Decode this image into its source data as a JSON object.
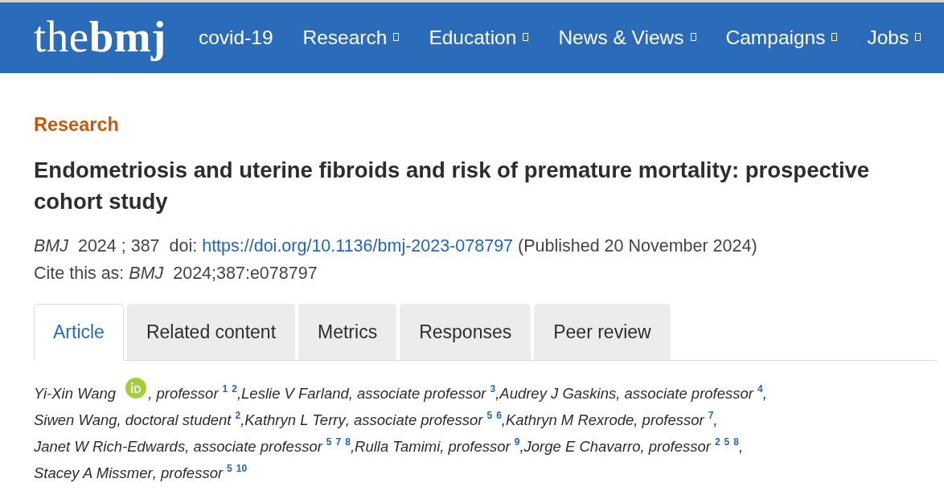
{
  "header": {
    "logo": "the**bmj**",
    "nav": [
      {
        "label": "covid-19",
        "has_dropdown": false
      },
      {
        "label": "Research",
        "has_dropdown": true
      },
      {
        "label": "Education",
        "has_dropdown": true
      },
      {
        "label": "News & Views",
        "has_dropdown": true
      },
      {
        "label": "Campaigns",
        "has_dropdown": true
      },
      {
        "label": "Jobs",
        "has_dropdown": true
      }
    ]
  },
  "article": {
    "section": "Research",
    "title": "Endometriosis and uterine fibroids and risk of premature mortality: prospective cohort study",
    "citation": {
      "text": "*BMJ*  2024 ; 387  doi:",
      "doi_url": "https://doi.org/10.1136/bmj-2023-078797",
      "published": "(Published 20 November 2024)"
    },
    "cite_as": "Cite this as: *BMJ*  2024;387:e078797",
    "tabs": [
      {
        "label": "Article",
        "selected": true
      },
      {
        "label": "Related content",
        "selected": false
      },
      {
        "label": "Metrics",
        "selected": false
      },
      {
        "label": "Responses",
        "selected": false
      },
      {
        "label": "Peer review",
        "selected": false
      }
    ],
    "authors": [
      {
        "name": "Yi-Xin Wang",
        "orcid": true,
        "role": ", professor",
        "affiliations": [
          "1",
          "2"
        ],
        "separator": ","
      },
      {
        "name": "Leslie V Farland",
        "orcid": false,
        "role": ", associate professor",
        "affiliations": [
          "3"
        ],
        "separator": ","
      },
      {
        "name": "Audrey J Gaskins",
        "orcid": false,
        "role": ", associate professor",
        "affiliations": [
          "4"
        ],
        "separator": ","
      },
      {
        "name": "Siwen Wang",
        "orcid": false,
        "role": ", doctoral student",
        "affiliations": [
          "2"
        ],
        "separator": ","
      },
      {
        "name": "Kathryn L Terry",
        "orcid": false,
        "role": ", associate professor",
        "affiliations": [
          "5",
          "6"
        ],
        "separator": ","
      },
      {
        "name": "Kathryn M Rexrode",
        "orcid": false,
        "role": ", professor",
        "affiliations": [
          "7"
        ],
        "separator": ","
      },
      {
        "name": "Janet W Rich-Edwards",
        "orcid": false,
        "role": ", associate professor",
        "affiliations": [
          "5",
          "7",
          "8"
        ],
        "separator": ","
      },
      {
        "name": "Rulla Tamimi",
        "orcid": false,
        "role": ", professor",
        "affiliations": [
          "9"
        ],
        "separator": ","
      },
      {
        "name": "Jorge E Chavarro",
        "orcid": false,
        "role": ", professor",
        "affiliations": [
          "2",
          "5",
          "8"
        ],
        "separator": ","
      },
      {
        "name": "Stacey A Missmer",
        "orcid": false,
        "role": ", professor",
        "affiliations": [
          "5",
          "10"
        ]
      }
    ]
  }
}
